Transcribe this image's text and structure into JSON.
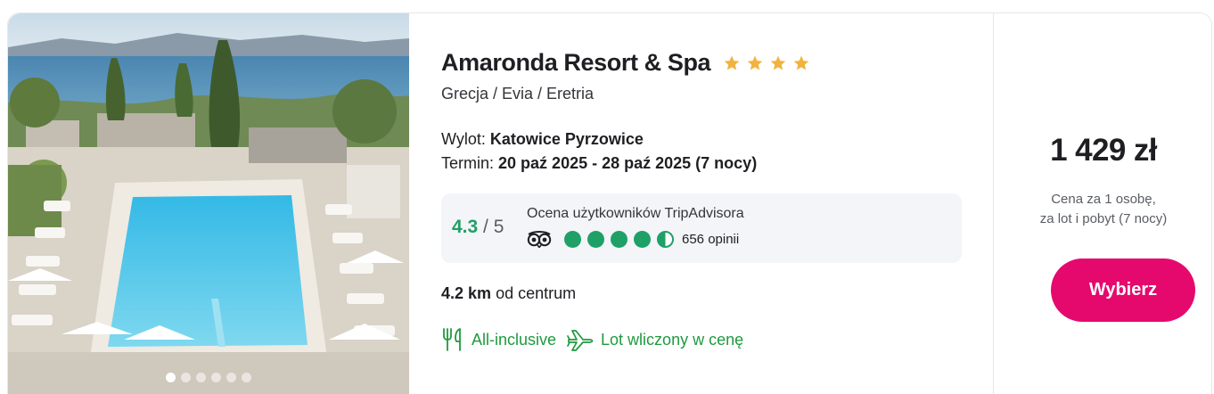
{
  "hotel": {
    "name": "Amaronda Resort & Spa",
    "stars": 4,
    "location": "Grecja / Evia / Eretria"
  },
  "gallery": {
    "slides": 6,
    "active_index": 0
  },
  "flight": {
    "departure_label": "Wylot:",
    "departure_airport": "Katowice Pyrzowice",
    "date_label": "Termin:",
    "date_range": "20 paź 2025 - 28 paź 2025 (7 nocy)"
  },
  "tripadvisor": {
    "score": "4.3",
    "max": "/ 5",
    "label": "Ocena użytkowników TripAdvisora",
    "rating_bubbles": 4.5,
    "reviews": "656 opinii",
    "icon": "tripadvisor-owl-icon"
  },
  "distance": {
    "value": "4.2 km",
    "suffix": "od centrum"
  },
  "features": [
    {
      "label": "All-inclusive",
      "icon": "fork-knife-icon"
    },
    {
      "label": "Lot wliczony w cenę",
      "icon": "plane-icon"
    }
  ],
  "pricing": {
    "price": "1 429 zł",
    "note_line1": "Cena za 1 osobę,",
    "note_line2": "za lot i pobyt (7 nocy)",
    "button_label": "Wybierz"
  },
  "colors": {
    "accent": "#e5096e",
    "rating_green": "#1fa066",
    "feature_green": "#1f9a3f",
    "star": "#f2b33d"
  }
}
